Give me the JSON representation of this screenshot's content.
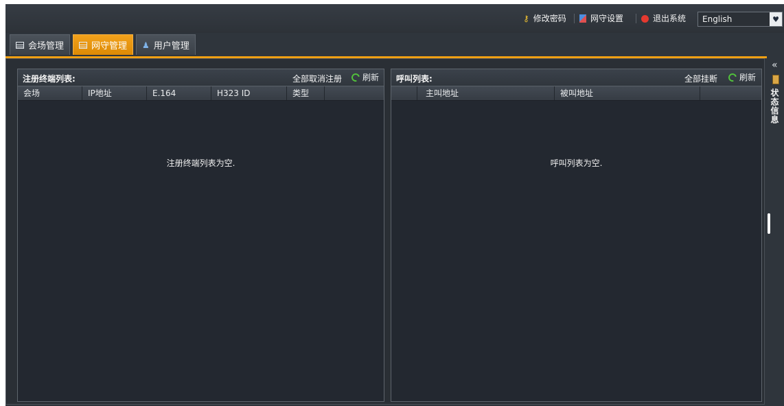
{
  "topbar": {
    "change_password": "修改密码",
    "gk_settings": "网守设置",
    "logout": "退出系统",
    "language": "English"
  },
  "tabs": [
    {
      "label": "会场管理",
      "icon": "grid-icon"
    },
    {
      "label": "网守管理",
      "icon": "grid-icon"
    },
    {
      "label": "用户管理",
      "icon": "user-icon"
    }
  ],
  "left_panel": {
    "title": "注册终端列表:",
    "action": "全部取消注册",
    "refresh": "刷新",
    "columns": [
      "会场",
      "IP地址",
      "E.164",
      "H323 ID",
      "类型"
    ],
    "empty_message": "注册终端列表为空."
  },
  "right_panel": {
    "title": "呼叫列表:",
    "action": "全部挂断",
    "refresh": "刷新",
    "columns": [
      "主叫地址",
      "被叫地址"
    ],
    "empty_message": "呼叫列表为空."
  },
  "sidebar": {
    "collapse": "«",
    "status_label": "状态信息"
  },
  "colors": {
    "accent": "#f0a013",
    "background": "#2f353c",
    "panel": "#232830"
  }
}
